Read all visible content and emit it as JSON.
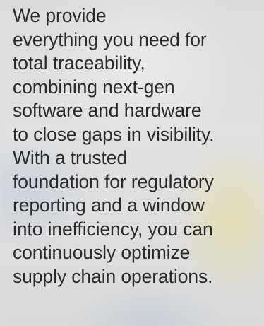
{
  "copy": {
    "lines": [
      "We provide",
      "everything you need for",
      "total traceability,",
      "combining next-gen",
      "software and hardware",
      "to close gaps in visibility.",
      "With a trusted",
      "foundation for regulatory",
      "reporting and a window",
      "into inefficiency, you can",
      "continuously optimize",
      "supply chain operations."
    ]
  },
  "colors": {
    "text": "#2a2a2a",
    "background": "#d8d8d8",
    "accent_yellow": "#f0dc50"
  }
}
